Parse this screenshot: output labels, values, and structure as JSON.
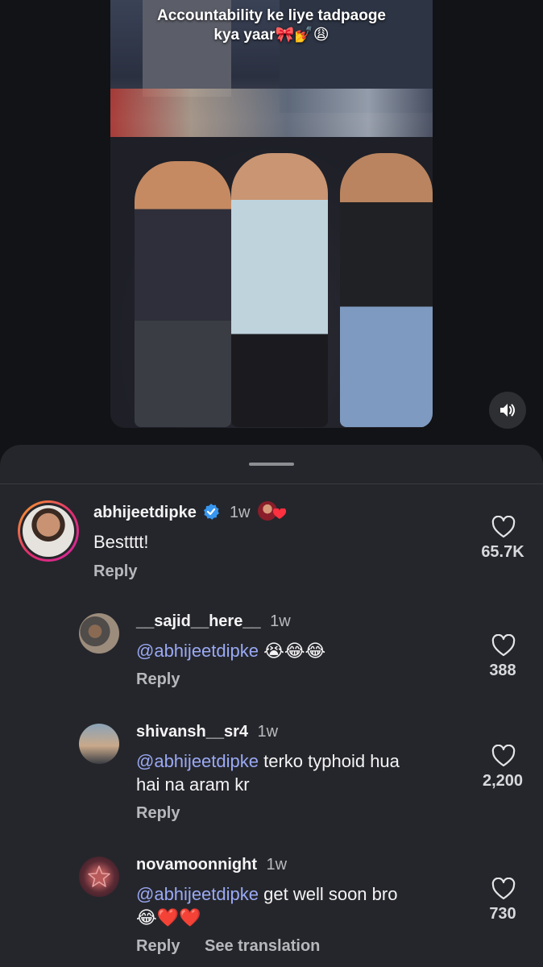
{
  "video": {
    "caption_line1": "Accountability ke liye tadpaoge",
    "caption_line2": "kya yaar🎀💅😩",
    "sound_icon": "speaker-icon"
  },
  "comments": [
    {
      "username": "abhijeetdipke",
      "verified": true,
      "time": "1w",
      "text": "Bestttt!",
      "reply_label": "Reply",
      "likes": "65.7K"
    },
    {
      "username": "__sajid__here__",
      "time": "1w",
      "mention": "@abhijeetdipke",
      "text": "😭😂😂",
      "reply_label": "Reply",
      "likes": "388"
    },
    {
      "username": "shivansh__sr4",
      "time": "1w",
      "mention": "@abhijeetdipke",
      "text_line1": "terko typhoid hua",
      "text_line2": "hai na aram kr",
      "reply_label": "Reply",
      "likes": "2,200"
    },
    {
      "username": "novamoonnight",
      "time": "1w",
      "mention": "@abhijeetdipke",
      "text_line1": "get well soon bro",
      "text_line2": "😂❤️❤️",
      "reply_label": "Reply",
      "translate_label": "See translation",
      "likes": "730"
    }
  ],
  "colors": {
    "background": "#121316",
    "sheet": "#25262b",
    "mention": "#9aa9f5",
    "verified": "#3897f0",
    "story_ring_start": "#f9a825",
    "story_ring_end": "#d6249f"
  }
}
